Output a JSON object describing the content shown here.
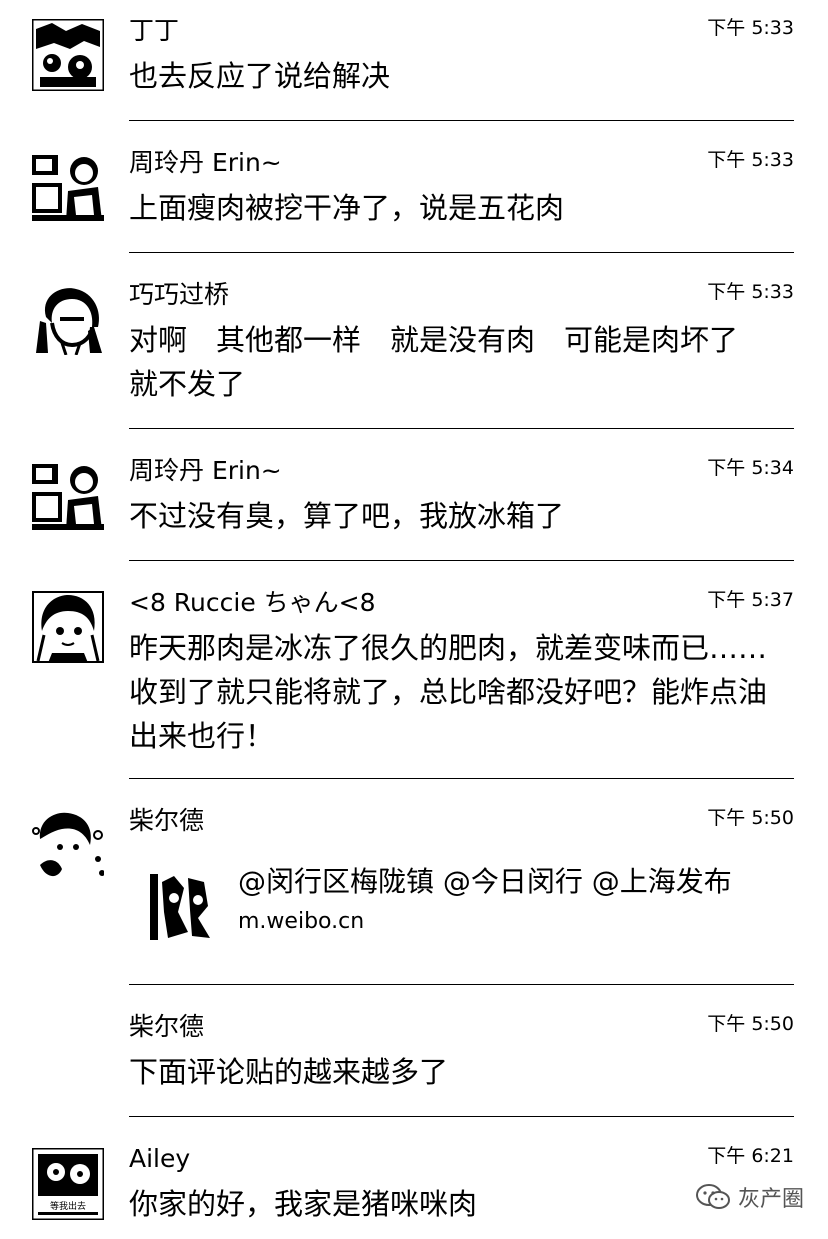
{
  "messages": [
    {
      "sender": "丁丁",
      "time": "下午 5:33",
      "text": "也去反应了说给解决",
      "avatar": "avatar-icon"
    },
    {
      "sender": "周玲丹 Erin~",
      "time": "下午 5:33",
      "text": "上面瘦肉被挖干净了，说是五花肉",
      "avatar": "avatar-icon"
    },
    {
      "sender": "巧巧过桥",
      "time": "下午 5:33",
      "text": "对啊　其他都一样　就是没有肉　可能是肉坏了　就不发了",
      "avatar": "avatar-icon"
    },
    {
      "sender": "周玲丹 Erin~",
      "time": "下午 5:34",
      "text": "不过没有臭，算了吧，我放冰箱了",
      "avatar": "avatar-icon"
    },
    {
      "sender": "<8 Ruccie ちゃん<8",
      "time": "下午 5:37",
      "text": "昨天那肉是冰冻了很久的肥肉，就差变味而已……收到了就只能将就了，总比啥都没好吧？能炸点油出来也行！",
      "avatar": "avatar-icon"
    },
    {
      "sender": "柴尔德",
      "time": "下午 5:50",
      "link": {
        "title": "@闵行区梅陇镇 @今日闵行 @上海发布",
        "url": "m.weibo.cn"
      },
      "avatar": "avatar-icon"
    },
    {
      "sender": "柴尔德",
      "time": "下午 5:50",
      "text": "下面评论贴的越来越多了"
    },
    {
      "sender": "Ailey",
      "time": "下午 6:21",
      "text": "你家的好，我家是猪咪咪肉",
      "avatar": "avatar-icon",
      "avatar_caption": "等我出去 请吃菜"
    }
  ],
  "watermark": {
    "label": "灰产圈",
    "icon": "wechat-icon"
  }
}
